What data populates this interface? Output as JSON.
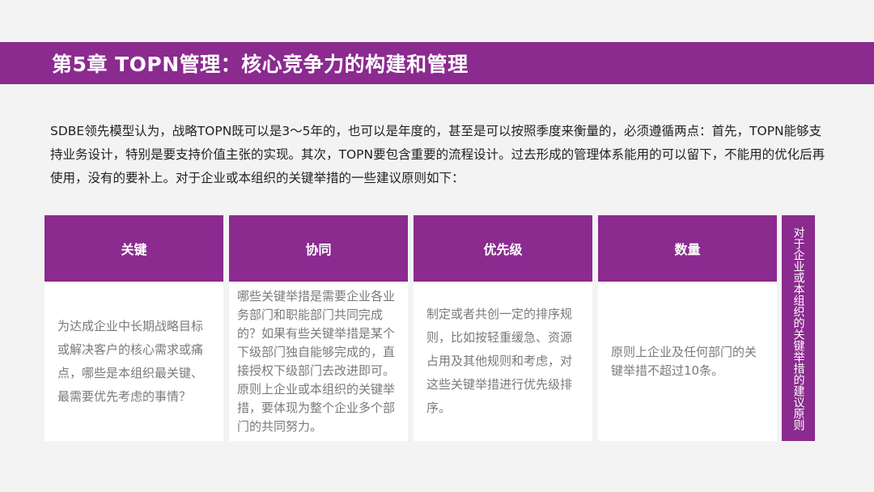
{
  "header": {
    "title": "第5章 TOPN管理：核心竞争力的构建和管理"
  },
  "intro": {
    "text": "SDBE领先模型认为，战略TOPN既可以是3～5年的，也可以是年度的，甚至是可以按照季度来衡量的，必须遵循两点：首先，TOPN能够支持业务设计，特别是要支持价值主张的实现。其次，TOPN要包含重要的流程设计。过去形成的管理体系能用的可以留下，不能用的优化后再使用，没有的要补上。对于企业或本组织的关键举措的一些建议原则如下："
  },
  "cards": [
    {
      "title": "关键",
      "text": "为达成企业中长期战略目标或解决客户的核心需求或痛点，哪些是本组织最关键、最需要优先考虑的事情？"
    },
    {
      "title": "协同",
      "text": "哪些关键举措是需要企业各业务部门和职能部门共同完成的？如果有些关键举措是某个下级部门独自能够完成的，直接授权下级部门去改进即可。原则上企业或本组织的关键举措，要体现为整个企业多个部门的共同努力。"
    },
    {
      "title": "优先级",
      "text": "制定或者共创一定的排序规则，比如按轻重缓急、资源占用及其他规则和考虑，对这些关键举措进行优先级排序。"
    },
    {
      "title": "数量",
      "text": "原则上企业及任何部门的关键举措不超过10条。"
    }
  ],
  "side_label": "对于企业或本组织的关键举措的建议原则",
  "colors": {
    "accent": "#8b2a8f",
    "background": "#f3f3f3",
    "card_body": "#ffffff",
    "body_text": "#7a7a7a"
  }
}
